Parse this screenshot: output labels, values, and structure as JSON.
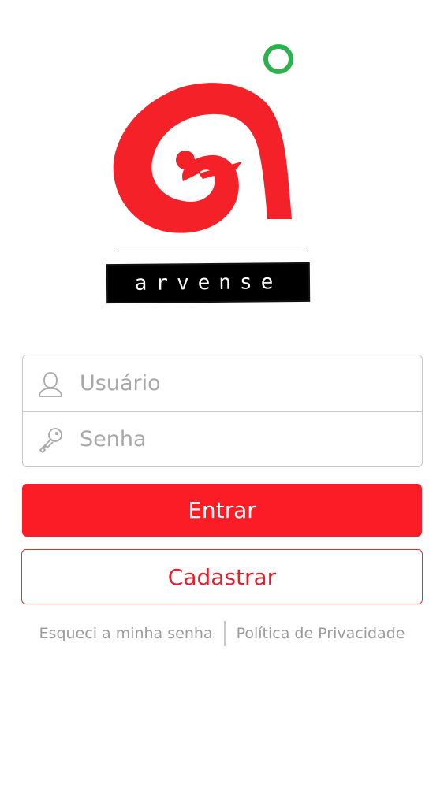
{
  "brand": {
    "wordmark": "arvense",
    "colors": {
      "logo_red": "#f52129",
      "logo_green": "#2bb24c",
      "primary": "#fb1c25",
      "secondary_border": "#e82a33"
    }
  },
  "login": {
    "username_placeholder": "Usuário",
    "password_placeholder": "Senha",
    "username_icon": "user-icon",
    "password_icon": "key-icon"
  },
  "actions": {
    "login_label": "Entrar",
    "register_label": "Cadastrar"
  },
  "footer": {
    "forgot_password": "Esqueci a minha senha",
    "privacy_policy": "Política de Privacidade"
  }
}
